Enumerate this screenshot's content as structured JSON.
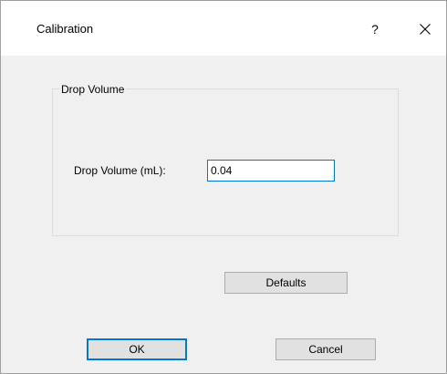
{
  "window": {
    "title": "Calibration",
    "help_label": "?",
    "close_icon": "close-icon"
  },
  "group": {
    "legend": "Drop Volume",
    "field_label": "Drop Volume (mL):",
    "field_value": "0.04"
  },
  "buttons": {
    "defaults_label": "Defaults",
    "ok_label": "OK",
    "cancel_label": "Cancel"
  },
  "colors": {
    "accent": "#0078d7",
    "dialog_background": "#f0f0f0",
    "titlebar_background": "#ffffff",
    "button_face": "#e1e1e1"
  }
}
